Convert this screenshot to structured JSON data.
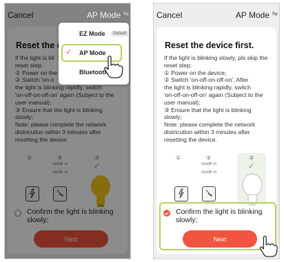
{
  "colors": {
    "accent": "#f1543f",
    "highlight": "#b4d455",
    "check_green": "#4caf50"
  },
  "left_panel": {
    "header": {
      "cancel": "Cancel",
      "mode": "AP Mode"
    },
    "title": "Reset the de",
    "instructions": [
      "If the light is bli",
      "reset step:",
      "① Power on the",
      "② Switch 'on-o",
      "the light is blinking rapidly, switch",
      "'on-off-on-off-on' again (Subject to the",
      "user manual);",
      "③ Ensure that the light is blinking",
      "slowly;",
      "Note: please complete the network",
      "districution within 3 minutes after",
      "resetting the device."
    ],
    "steps": {
      "s1": "①",
      "s2": "②",
      "s3": "③",
      "onoff1": "On/Off ×3",
      "dots": "···",
      "onoff2": "On/Off ×3"
    },
    "confirm": "Confirm the light is blinking slowly;",
    "next": "Next",
    "menu": {
      "items": [
        {
          "label": "EZ Mode",
          "badge": "Default"
        },
        {
          "label": "AP Mode"
        },
        {
          "label": "Bluetooth"
        }
      ]
    }
  },
  "right_panel": {
    "header": {
      "cancel": "Cancel",
      "mode": "AP Mode"
    },
    "title": "Reset the device first.",
    "instructions": [
      "If the light is blinking slowly, pls skip the",
      "reset step:",
      "① Power on the device;",
      "② Switch 'on-off-on-off-on'. After",
      "the light is blinking rapidly, switch",
      "'on-off-on-off-on' again (Subject to the",
      "user manual);",
      "③ Ensure that the light is blinking",
      "slowly;",
      "Note: please complete the network",
      "districution within 3 minutes after",
      "resetting the device."
    ],
    "steps": {
      "s1": "①",
      "s2": "②",
      "s3": "③",
      "onoff1": "On/Off ×3",
      "dots": "···",
      "onoff2": "On/Off ×3"
    },
    "confirm": "Confirm the light is blinking slowly;",
    "next": "Next"
  }
}
